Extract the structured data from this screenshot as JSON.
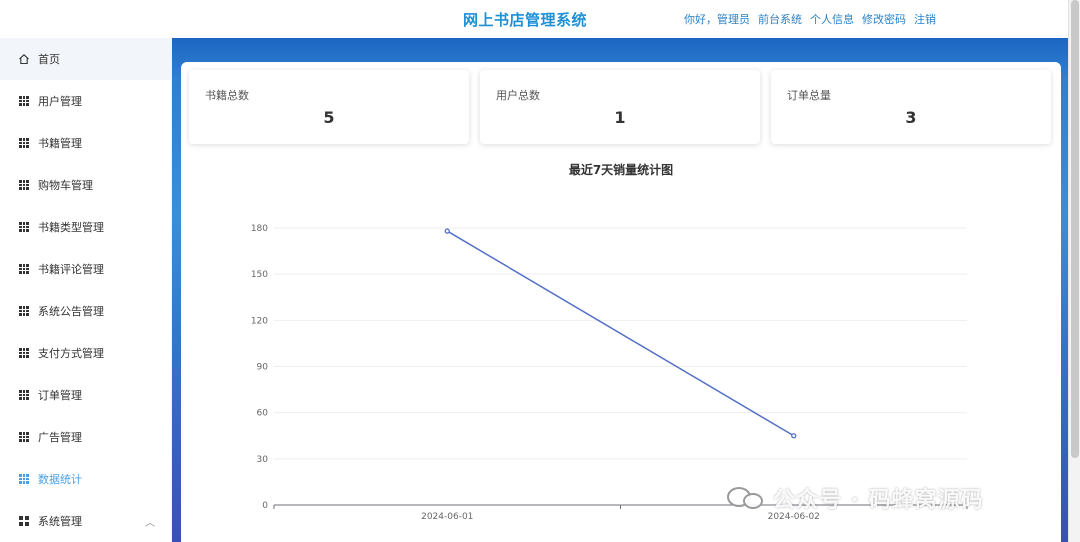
{
  "header": {
    "title": "网上书店管理系统",
    "greeting": "你好，管理员",
    "links": [
      "前台系统",
      "个人信息",
      "修改密码",
      "注销"
    ]
  },
  "sidebar": {
    "home": "首页",
    "items": [
      {
        "label": "用户管理",
        "icon": "grid-icon"
      },
      {
        "label": "书籍管理",
        "icon": "grid-icon"
      },
      {
        "label": "购物车管理",
        "icon": "grid-icon"
      },
      {
        "label": "书籍类型管理",
        "icon": "grid-icon"
      },
      {
        "label": "书籍评论管理",
        "icon": "grid-icon"
      },
      {
        "label": "系统公告管理",
        "icon": "grid-icon"
      },
      {
        "label": "支付方式管理",
        "icon": "grid-icon"
      },
      {
        "label": "订单管理",
        "icon": "grid-icon"
      },
      {
        "label": "广告管理",
        "icon": "grid-icon"
      },
      {
        "label": "数据统计",
        "icon": "grid-icon",
        "active": true
      },
      {
        "label": "系统管理",
        "icon": "apps-icon",
        "expandable": true
      }
    ]
  },
  "stats": [
    {
      "label": "书籍总数",
      "value": "5"
    },
    {
      "label": "用户总数",
      "value": "1"
    },
    {
      "label": "订单总量",
      "value": "3"
    }
  ],
  "chart_data": {
    "type": "line",
    "title": "最近7天销量统计图",
    "categories": [
      "2024-06-01",
      "2024-06-02"
    ],
    "series": [
      {
        "values": [
          178,
          45
        ]
      }
    ],
    "ylim": [
      0,
      180
    ],
    "yticks": [
      0,
      30,
      60,
      90,
      120,
      150,
      180
    ],
    "grid": true,
    "color": "#5470c6"
  },
  "watermark": "公众号 · 码蜂窝源码",
  "colors": {
    "accent": "#1e90d6",
    "active": "#4a9fe8"
  }
}
